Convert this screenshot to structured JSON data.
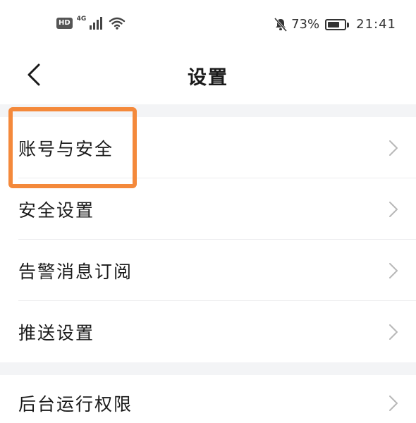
{
  "status_bar": {
    "hd": "HD",
    "network": "4G",
    "battery_percent": "73%",
    "battery_level": 0.73,
    "time": "21:41"
  },
  "nav": {
    "title": "设置"
  },
  "groups": [
    {
      "items": [
        {
          "label": "账号与安全"
        },
        {
          "label": "安全设置"
        },
        {
          "label": "告警消息订阅"
        },
        {
          "label": "推送设置"
        }
      ]
    },
    {
      "items": [
        {
          "label": "后台运行权限"
        }
      ]
    }
  ],
  "colors": {
    "highlight": "#f4893b",
    "section_gap": "#f3f4f6",
    "chevron": "#b8b8b8"
  }
}
